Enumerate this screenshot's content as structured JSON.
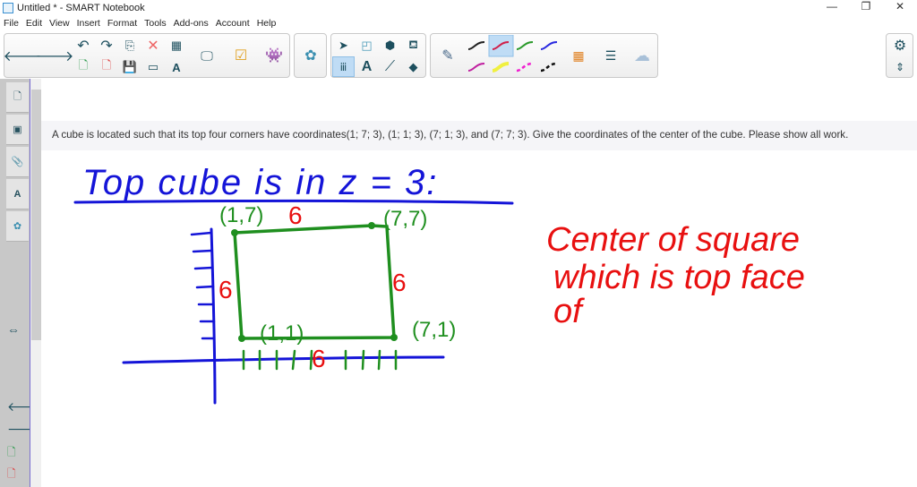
{
  "window": {
    "title": "Untitled * - SMART Notebook",
    "controls": [
      "—",
      "❐",
      "✕"
    ]
  },
  "menu": [
    "File",
    "Edit",
    "View",
    "Insert",
    "Format",
    "Tools",
    "Add-ons",
    "Account",
    "Help"
  ],
  "question": "A cube is located such that its top four corners have coordinates(1; 7; 3), (1; 1; 3), (7; 1; 3), and (7; 7; 3). Give the coordinates of the center of the cube. Please show all work.",
  "handwriting": {
    "heading": "Top cube is in z = 3:",
    "corner_tl": "(1,7)",
    "corner_tr": "(7,7)",
    "corner_bl": "(1,1)",
    "corner_br": "(7,1)",
    "side_top": "6",
    "side_right": "6",
    "side_left": "6",
    "side_bottom": "6",
    "note_line1": "Center of square",
    "note_line2": "which is top face",
    "note_line3": "of"
  },
  "colors": {
    "blue": "#1414d8",
    "green": "#1f8f1f",
    "red": "#e81010"
  }
}
